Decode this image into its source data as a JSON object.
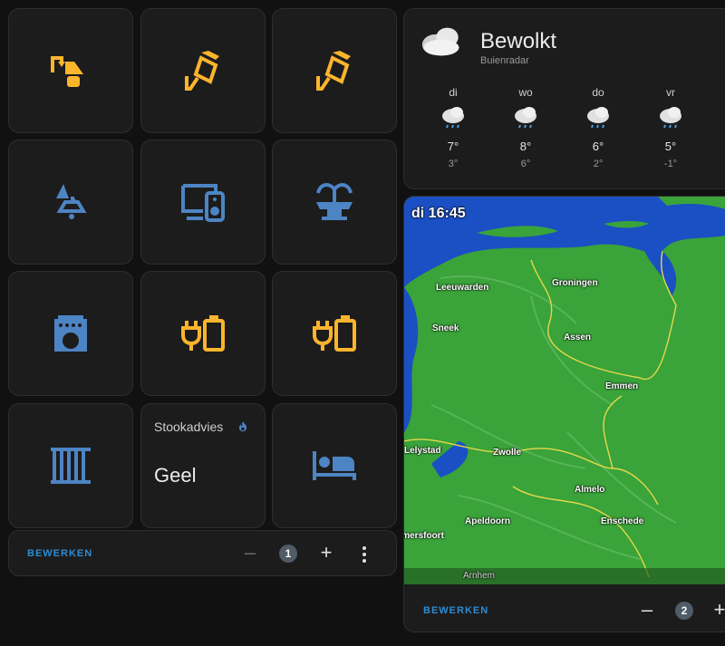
{
  "left_panel": {
    "stook_tile": {
      "label": "Stookadvies",
      "value": "Geel"
    },
    "footer": {
      "edit_label": "BEWERKEN",
      "minus": "–",
      "page": "1",
      "plus": "+"
    }
  },
  "weather": {
    "condition": "Bewolkt",
    "source": "Buienradar",
    "forecast": [
      {
        "day": "di",
        "high": "7°",
        "low": "3°"
      },
      {
        "day": "wo",
        "high": "8°",
        "low": "6°"
      },
      {
        "day": "do",
        "high": "6°",
        "low": "2°"
      },
      {
        "day": "vr",
        "high": "5°",
        "low": "-1°"
      }
    ]
  },
  "radar": {
    "timestamp": "di 16:45",
    "cities": [
      "Leeuwarden",
      "Groningen",
      "Sneek",
      "Assen",
      "Emmen",
      "Lelystad",
      "Zwolle",
      "Almelo",
      "Apeldoorn",
      "Enschede",
      "Amersfoort",
      "Arnhem"
    ]
  },
  "right_footer": {
    "edit_label": "BEWERKEN",
    "minus": "–",
    "page": "2",
    "plus": "+"
  },
  "colors": {
    "active": "#fbb52d",
    "inactive": "#4d84c4",
    "accent": "#2f8bd1",
    "land": "#3aa33a",
    "water": "#1b4fc4"
  }
}
